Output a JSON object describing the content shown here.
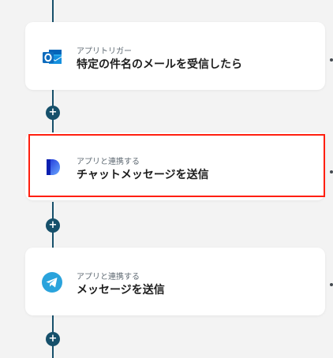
{
  "flow": {
    "steps": [
      {
        "kind_label": "アプリトリガー",
        "title": "特定の件名のメールを受信したら",
        "icon": "outlook-icon"
      },
      {
        "kind_label": "アプリと連携する",
        "title": "チャットメッセージを送信",
        "icon": "d-app-icon"
      },
      {
        "kind_label": "アプリと連携する",
        "title": "メッセージを送信",
        "icon": "telegram-icon"
      }
    ],
    "add_step_symbol": "+"
  },
  "colors": {
    "connector": "#16506b",
    "highlight": "#ff1f0f",
    "background": "#f3f3f3",
    "outlook_blue": "#0f6cbd",
    "telegram_blue": "#2aa3dc"
  }
}
